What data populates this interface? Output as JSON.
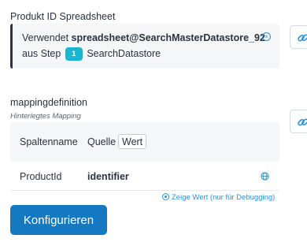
{
  "spreadsheet_section": {
    "label": "Produkt ID Spreadsheet",
    "prefix": "Verwendet ",
    "spreadsheet_name": "spreadsheet@SearchMasterDatastore_92",
    "step_prefix": "aus Step ",
    "step_number": "1",
    "step_name": "SearchDatastore"
  },
  "mapping_section": {
    "label": "mappingdefinition",
    "sublabel": "Hinterlegtes Mapping",
    "header": {
      "column_name": "Spaltenname",
      "source_label": "Quelle",
      "value_toggle": "Wert"
    },
    "rows": [
      {
        "column": "ProductId",
        "value": "identifier"
      }
    ],
    "debug_link": "Zeige Wert (nur für Debugging)"
  },
  "actions": {
    "configure_button": "Konfigurieren"
  },
  "colors": {
    "accent": "#1479c1",
    "badge": "#1ab5d0",
    "link": "#2f8fd6"
  }
}
